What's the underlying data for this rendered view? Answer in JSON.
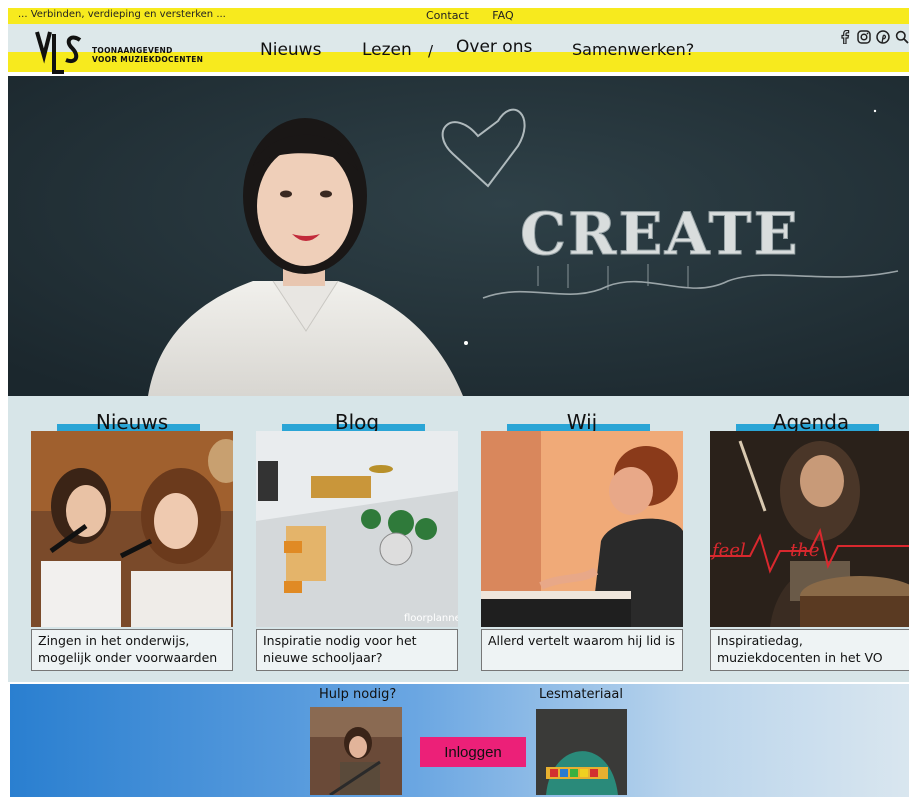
{
  "topbar": {
    "tagline": "... Verbinden, verdieping en versterken ...",
    "contact": "Contact",
    "faq": "FAQ"
  },
  "header": {
    "logo_text_line1": "TOONAANGEVEND",
    "logo_text_line2": "VOOR MUZIEKDOCENTEN",
    "logo_letters": "VLS",
    "nav": {
      "nieuws": "Nieuws",
      "lezen": "Lezen",
      "separator": "/",
      "over_ons": "Over ons",
      "samenwerken": "Samenwerken?"
    },
    "social_icons": [
      "facebook-icon",
      "instagram-icon",
      "pinterest-icon",
      "search-icon"
    ]
  },
  "hero": {
    "chalk_text": "CREATE"
  },
  "cards": [
    {
      "title": "Nieuws",
      "caption": "Zingen in het onderwijs, mogelijk onder voorwaarden"
    },
    {
      "title": "Blog",
      "caption": "Inspiratie nodig voor het nieuwe schooljaar?",
      "watermark": "floorplanner"
    },
    {
      "title": "Wij",
      "caption": "Allerd vertelt waarom hij lid is"
    },
    {
      "title": "Agenda",
      "caption": "Inspiratiedag, muziekdocenten in het VO",
      "overlay_word1": "feel",
      "overlay_word2": "the"
    }
  ],
  "footer": {
    "help_label": "Hulp nodig?",
    "lesson_label": "Lesmateriaal",
    "login_label": "Inloggen"
  },
  "colors": {
    "yellow": "#f7ea1e",
    "header_bg": "#dde8ea",
    "tab_blue": "#2aa5d6",
    "login_pink": "#ec2078"
  }
}
